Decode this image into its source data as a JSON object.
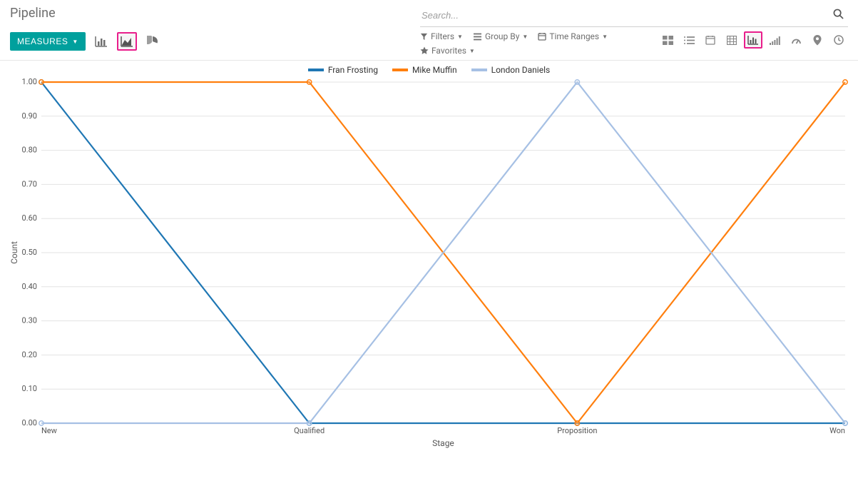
{
  "page_title": "Pipeline",
  "toolbar": {
    "measures_label": "MEASURES"
  },
  "search": {
    "placeholder": "Search..."
  },
  "filters": {
    "filters_label": "Filters",
    "group_by_label": "Group By",
    "time_ranges_label": "Time Ranges",
    "favorites_label": "Favorites"
  },
  "chart_data": {
    "type": "line",
    "title": "",
    "xlabel": "Stage",
    "ylabel": "Count",
    "ylim": [
      0,
      1.0
    ],
    "yticks": [
      0.0,
      0.1,
      0.2,
      0.3,
      0.4,
      0.5,
      0.6,
      0.7,
      0.8,
      0.9,
      1.0
    ],
    "x": [
      "New",
      "Qualified",
      "Proposition",
      "Won"
    ],
    "series": [
      {
        "name": "Fran Frosting",
        "values": [
          1.0,
          0.0,
          0.0,
          0.0
        ],
        "color": "#1f77b4"
      },
      {
        "name": "Mike Muffin",
        "values": [
          1.0,
          1.0,
          0.0,
          1.0
        ],
        "color": "#ff7f0e"
      },
      {
        "name": "London Daniels",
        "values": [
          0.0,
          0.0,
          1.0,
          0.0
        ],
        "color": "#a6c0e4"
      }
    ],
    "legend_position": "top"
  }
}
